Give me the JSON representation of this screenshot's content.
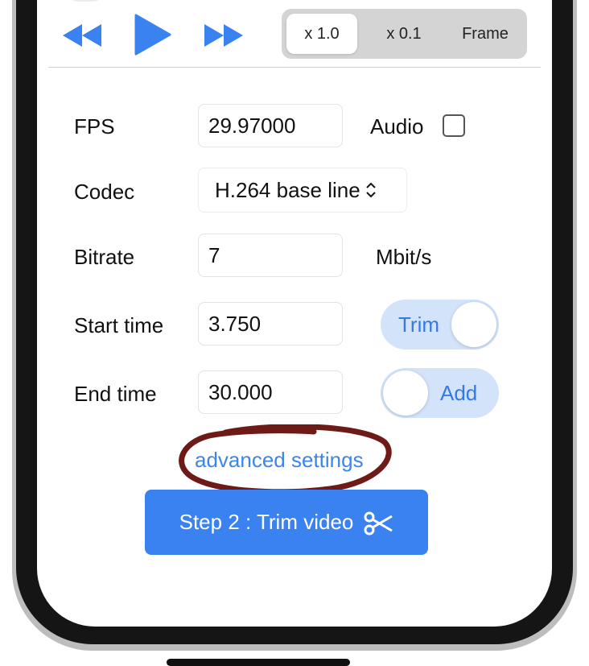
{
  "playback": {
    "rewind_icon": "rewind-icon",
    "play_icon": "play-icon",
    "forward_icon": "fast-forward-icon",
    "speed_options": [
      "x 1.0",
      "x 0.1",
      "Frame"
    ],
    "selected_speed": "x 1.0"
  },
  "form": {
    "fps_label": "FPS",
    "fps_value": "29.97000",
    "audio_label": "Audio",
    "audio_checked": false,
    "codec_label": "Codec",
    "codec_value": "H.264 base line",
    "bitrate_label": "Bitrate",
    "bitrate_value": "7",
    "bitrate_unit": "Mbit/s",
    "start_label": "Start time",
    "start_value": "3.750",
    "trim_toggle_label": "Trim",
    "end_label": "End time",
    "end_value": "30.000",
    "add_toggle_label": "Add"
  },
  "advanced_link": "advanced settings",
  "primary_button": {
    "label": "Step 2 : Trim video",
    "icon": "scissors-icon"
  },
  "colors": {
    "accent": "#3a82f0",
    "link": "#3c86e8",
    "toggle_bg": "#d3e3fa",
    "annotation": "#6e1a16"
  }
}
